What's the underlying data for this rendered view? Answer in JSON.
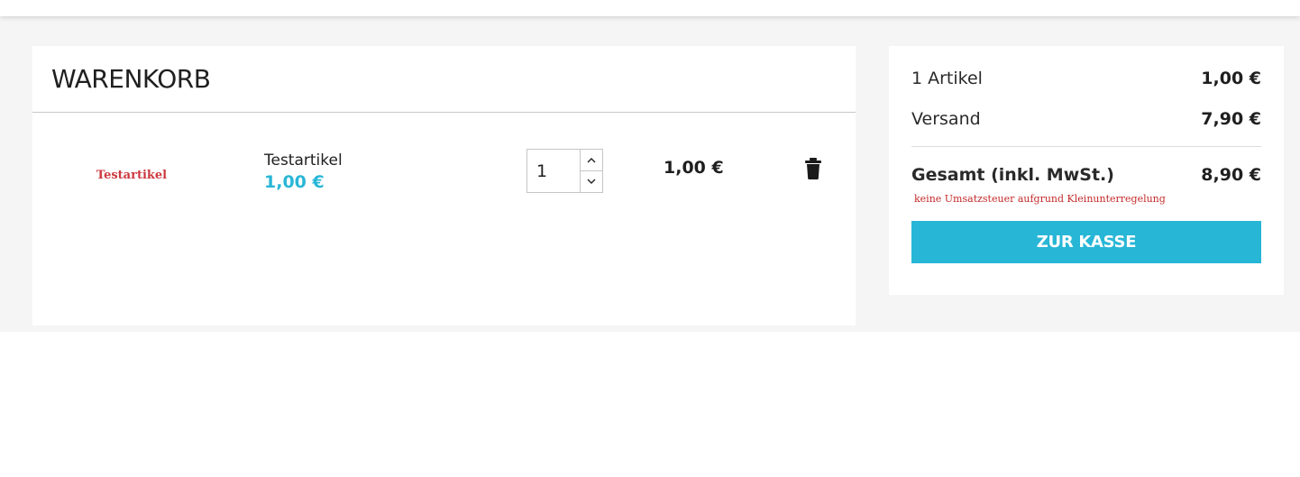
{
  "cart": {
    "title": "WARENKORB",
    "items": [
      {
        "image_text": "Testartikel",
        "name": "Testartikel",
        "unit_price": "1,00 €",
        "quantity": "1",
        "line_total": "1,00 €"
      }
    ]
  },
  "summary": {
    "items_label": "1 Artikel",
    "items_value": "1,00 €",
    "shipping_label": "Versand",
    "shipping_value": "7,90 €",
    "total_label": "Gesamt (inkl. MwSt.)",
    "total_value": "8,90 €",
    "tax_note": "keine Umsatzsteuer aufgrund Kleinunterregelung",
    "checkout_label": "ZUR KASSE"
  },
  "icons": {
    "delete": "trash-icon",
    "qty_up": "chevron-up-icon",
    "qty_down": "chevron-down-icon"
  },
  "colors": {
    "accent": "#27b6d6",
    "price": "#2ab6d6",
    "note": "#c42a2a",
    "product_image_text": "#cc3a3f"
  }
}
